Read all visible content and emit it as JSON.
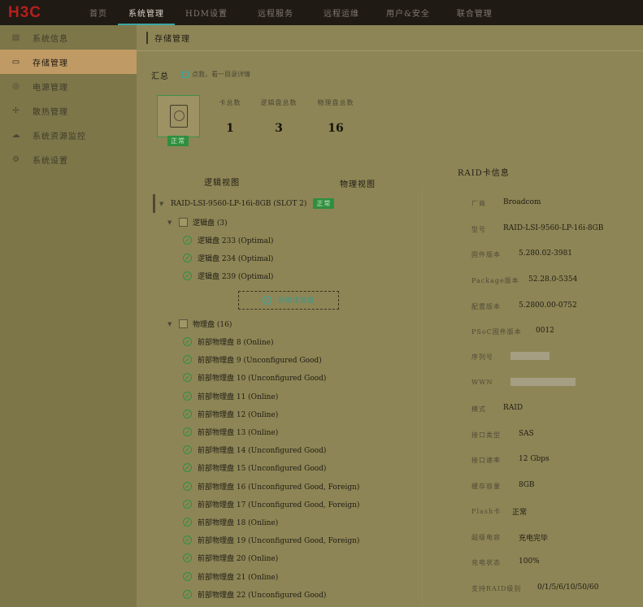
{
  "header": {
    "logo": "H3C",
    "nav": [
      "首页",
      "系统管理",
      "HDM设置",
      "远程服务",
      "远程运维",
      "用户&安全",
      "联合管理"
    ],
    "active_nav": 1
  },
  "sidebar": {
    "items": [
      {
        "label": "系统信息",
        "icon": "system-info-icon"
      },
      {
        "label": "存储管理",
        "icon": "storage-icon"
      },
      {
        "label": "电源管理",
        "icon": "power-icon"
      },
      {
        "label": "散热管理",
        "icon": "fan-icon"
      },
      {
        "label": "系统资源监控",
        "icon": "monitor-icon"
      },
      {
        "label": "系统设置",
        "icon": "settings-icon"
      }
    ],
    "active": 1
  },
  "main": {
    "title": "存储管理",
    "summary": {
      "label": "汇总",
      "hint": "点我，看一目录详情",
      "status_badge": "正常",
      "stats": [
        {
          "label": "卡总数",
          "value": "1"
        },
        {
          "label": "逻辑盘总数",
          "value": "3"
        },
        {
          "label": "物理盘总数",
          "value": "16"
        }
      ]
    },
    "views": {
      "logical": "逻辑视图",
      "physical": "物理视图"
    },
    "tree": {
      "controller": "RAID-LSI-9560-LP-16i-8GB (SLOT 2)",
      "controller_status": "正常",
      "logical_group": "逻辑盘 (3)",
      "logical_disks": [
        "逻辑盘 233 (Optimal)",
        "逻辑盘 234 (Optimal)",
        "逻辑盘 239 (Optimal)"
      ],
      "create_button": "创建逻辑盘",
      "physical_group": "物理盘 (16)",
      "physical_disks": [
        "前部物理盘 8 (Online)",
        "前部物理盘 9 (Unconfigured Good)",
        "前部物理盘 10 (Unconfigured Good)",
        "前部物理盘 11 (Online)",
        "前部物理盘 12 (Online)",
        "前部物理盘 13 (Online)",
        "前部物理盘 14 (Unconfigured Good)",
        "前部物理盘 15 (Unconfigured Good)",
        "前部物理盘 16 (Unconfigured Good, Foreign)",
        "前部物理盘 17 (Unconfigured Good, Foreign)",
        "前部物理盘 18 (Online)",
        "前部物理盘 19 (Unconfigured Good, Foreign)",
        "前部物理盘 20 (Online)",
        "前部物理盘 21 (Online)",
        "前部物理盘 22 (Unconfigured Good)"
      ]
    },
    "raid_info": {
      "title": "RAID卡信息",
      "rows": [
        {
          "label": "厂商",
          "value": "Broadcom"
        },
        {
          "label": "型号",
          "value": "RAID-LSI-9560-LP-16i-8GB"
        },
        {
          "label": "固件版本",
          "value": "5.280.02-3981"
        },
        {
          "label": "Package版本",
          "value": "52.28.0-5354"
        },
        {
          "label": "配置版本",
          "value": "5.2800.00-0752"
        },
        {
          "label": "PSoC固件版本",
          "value": "0012"
        },
        {
          "label": "序列号",
          "value": ""
        },
        {
          "label": "WWN",
          "value": ""
        },
        {
          "label": "模式",
          "value": "RAID"
        },
        {
          "label": "接口类型",
          "value": "SAS"
        },
        {
          "label": "接口速率",
          "value": "12 Gbps"
        },
        {
          "label": "缓存容量",
          "value": "8GB"
        },
        {
          "label": "Flash卡",
          "value": "正常"
        },
        {
          "label": "超级电容",
          "value": "充电完毕"
        },
        {
          "label": "充电状态",
          "value": "100%"
        },
        {
          "label": "支持RAID级别",
          "value": "0/1/5/6/10/50/60"
        }
      ]
    }
  }
}
